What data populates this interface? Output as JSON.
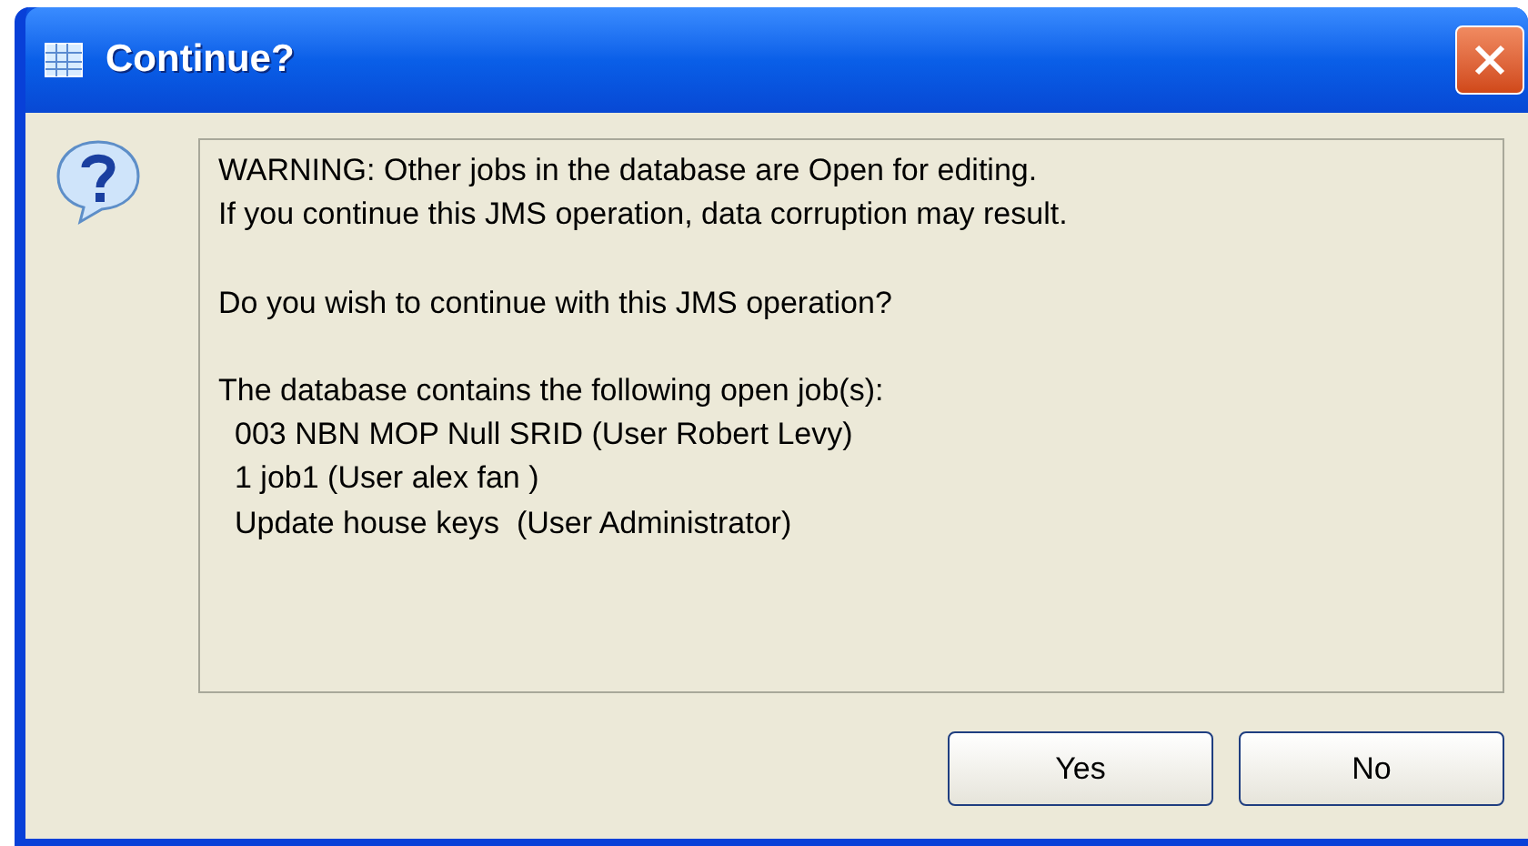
{
  "window": {
    "title": "Continue?"
  },
  "message": {
    "paragraphs": [
      [
        "WARNING: Other jobs in the database are Open for editing.",
        "If you continue this JMS operation, data corruption may result."
      ],
      [
        "Do you wish to continue with this JMS operation?"
      ],
      [
        "The database contains the following open job(s):",
        "003 NBN MOP Null SRID (User Robert Levy)",
        "1 job1 (User alex fan )",
        "Update house keys  (User Administrator)"
      ]
    ]
  },
  "buttons": [
    {
      "label": "Yes"
    },
    {
      "label": "No"
    }
  ]
}
